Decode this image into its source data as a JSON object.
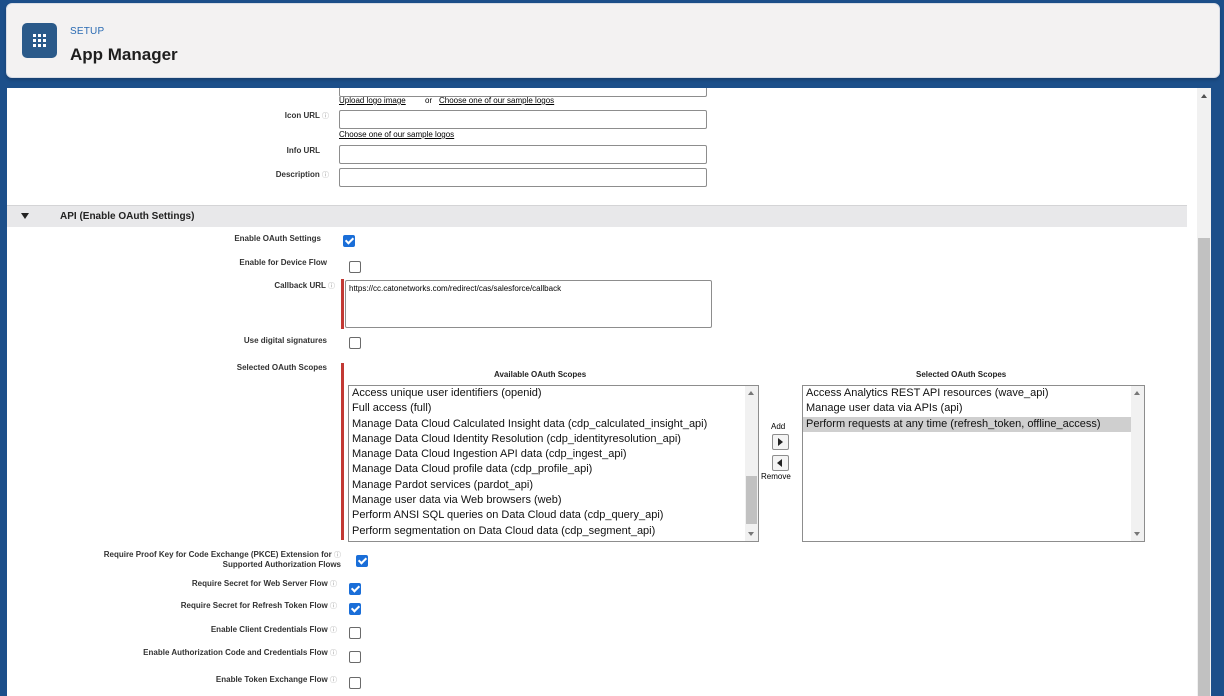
{
  "header": {
    "breadcrumb": "SETUP",
    "title": "App Manager"
  },
  "basic_info": {
    "upload_logo_link": "Upload logo image",
    "or_text": "or",
    "sample_logos_link": "Choose one of our sample logos",
    "icon_url_label": "Icon URL",
    "icon_sample_link": "Choose one of our sample logos",
    "info_url_label": "Info URL",
    "description_label": "Description"
  },
  "api_section": {
    "title": "API (Enable OAuth Settings)",
    "enable_oauth_label": "Enable OAuth Settings",
    "device_flow_label": "Enable for Device Flow",
    "callback_url_label": "Callback URL",
    "callback_url_value": "https://cc.catonetworks.com/redirect/cas/salesforce/callback",
    "digital_signatures_label": "Use digital signatures",
    "scopes_label": "Selected OAuth Scopes",
    "available_header": "Available OAuth Scopes",
    "selected_header": "Selected OAuth Scopes",
    "add_label": "Add",
    "remove_label": "Remove",
    "available_scopes": [
      "Access unique user identifiers (openid)",
      "Full access (full)",
      "Manage Data Cloud Calculated Insight data (cdp_calculated_insight_api)",
      "Manage Data Cloud Identity Resolution (cdp_identityresolution_api)",
      "Manage Data Cloud Ingestion API data (cdp_ingest_api)",
      "Manage Data Cloud profile data (cdp_profile_api)",
      "Manage Pardot services (pardot_api)",
      "Manage user data via Web browsers (web)",
      "Perform ANSI SQL queries on Data Cloud data (cdp_query_api)",
      "Perform segmentation on Data Cloud data (cdp_segment_api)"
    ],
    "selected_scopes": [
      "Access Analytics REST API resources (wave_api)",
      "Manage user data via APIs (api)",
      "Perform requests at any time (refresh_token, offline_access)"
    ],
    "pkce_label_line1": "Require Proof Key for Code Exchange (PKCE) Extension for",
    "pkce_label_line2": "Supported Authorization Flows",
    "secret_web_server_label": "Require Secret for Web Server Flow",
    "secret_refresh_label": "Require Secret for Refresh Token Flow",
    "client_credentials_label": "Enable Client Credentials Flow",
    "auth_code_credentials_label": "Enable Authorization Code and Credentials Flow",
    "token_exchange_label": "Enable Token Exchange Flow"
  },
  "checkbox_states": {
    "enable_oauth": true,
    "device_flow": false,
    "digital_signatures": false,
    "pkce": true,
    "secret_web_server": true,
    "secret_refresh": true,
    "client_credentials": false,
    "auth_code_credentials": false,
    "token_exchange": false
  },
  "colors": {
    "background": "#1c4f8a",
    "accent": "#2a5a8a",
    "checkbox_checked": "#1a6ed8",
    "required_bar": "#c23934",
    "selected_option": "#cfcfcf"
  }
}
